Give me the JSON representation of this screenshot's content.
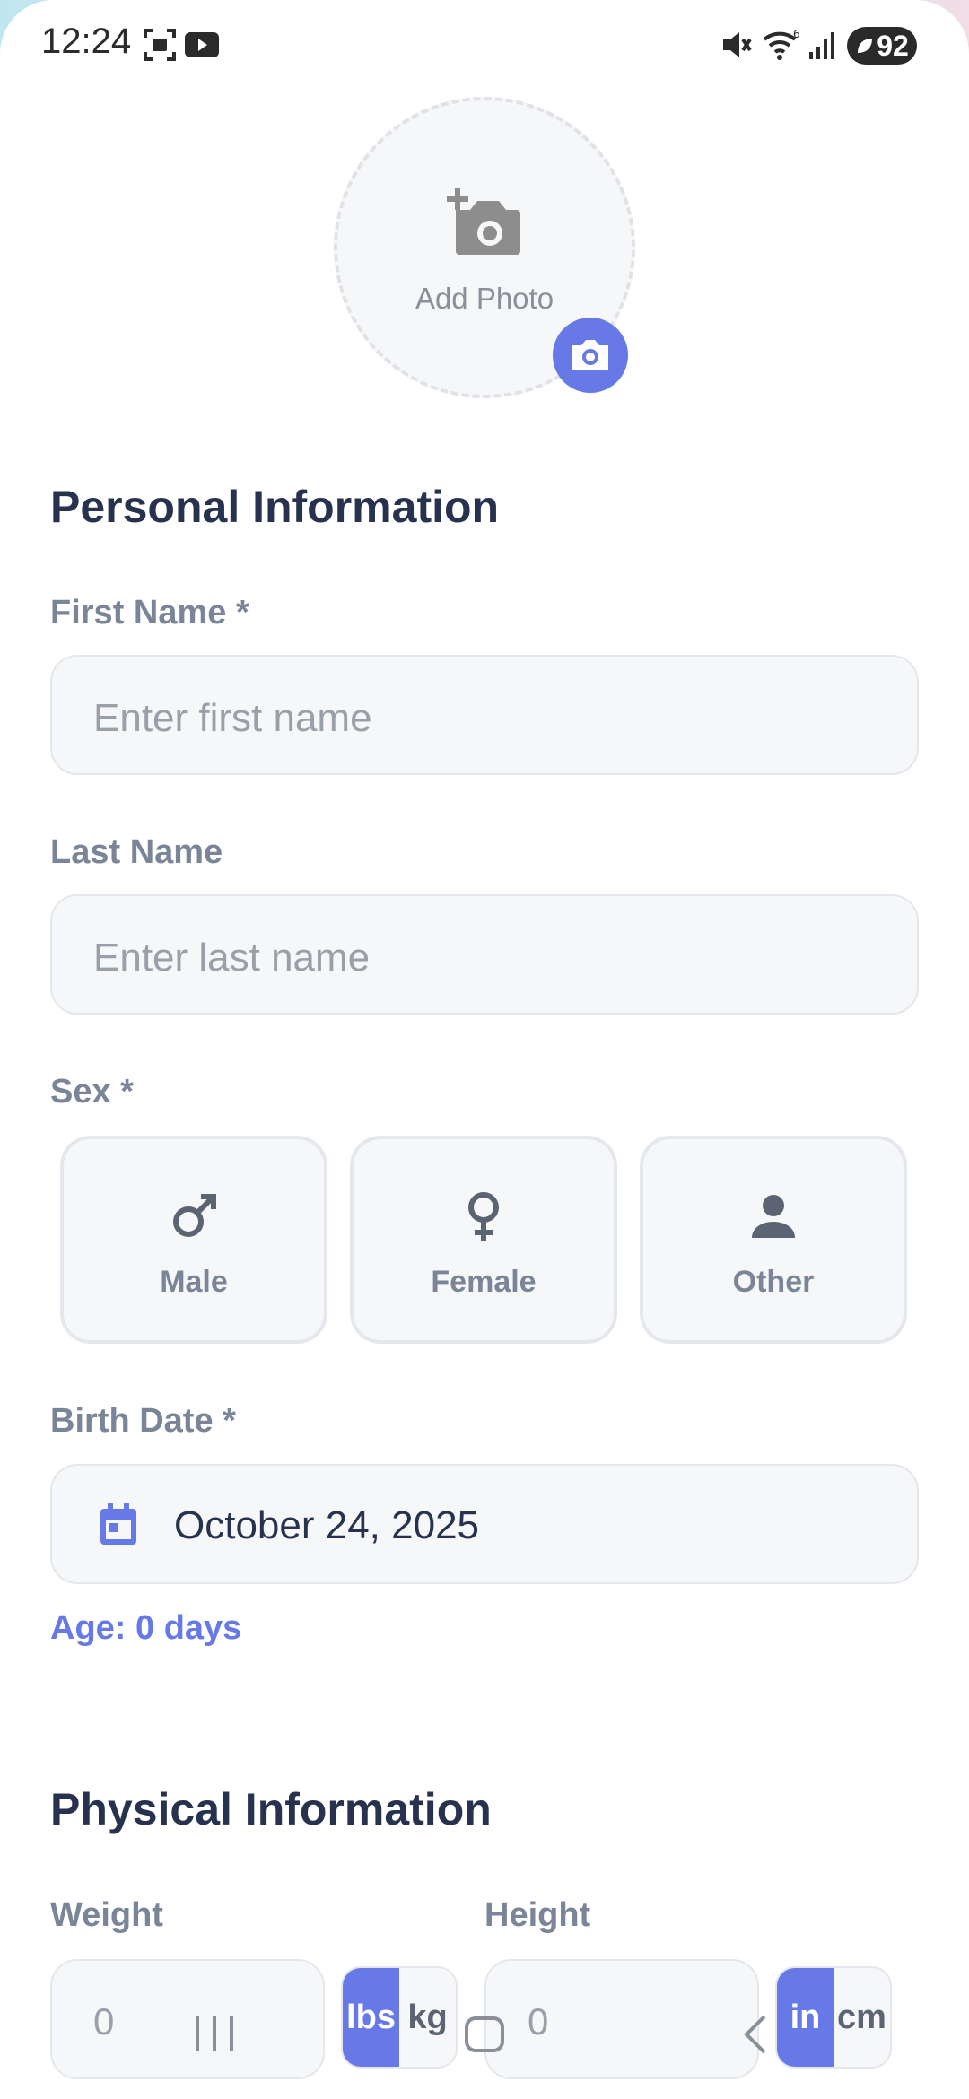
{
  "status_bar": {
    "time": "12:24",
    "battery": "92"
  },
  "photo": {
    "label": "Add Photo"
  },
  "personal": {
    "title": "Personal Information",
    "first_name": {
      "label": "First Name *",
      "placeholder": "Enter first name"
    },
    "last_name": {
      "label": "Last Name",
      "placeholder": "Enter last name"
    },
    "sex": {
      "label": "Sex *",
      "options": [
        "Male",
        "Female",
        "Other"
      ]
    },
    "birth_date": {
      "label": "Birth Date *",
      "value": "October 24, 2025"
    },
    "age": "Age: 0 days"
  },
  "physical": {
    "title": "Physical Information",
    "weight": {
      "label": "Weight",
      "value": "0",
      "units": [
        "lbs",
        "kg"
      ],
      "selected_unit": "lbs"
    },
    "height": {
      "label": "Height",
      "value": "0",
      "units": [
        "in",
        "cm"
      ],
      "selected_unit": "in"
    }
  },
  "colors": {
    "accent": "#6679e6",
    "heading": "#27324f",
    "label": "#7a8698"
  }
}
